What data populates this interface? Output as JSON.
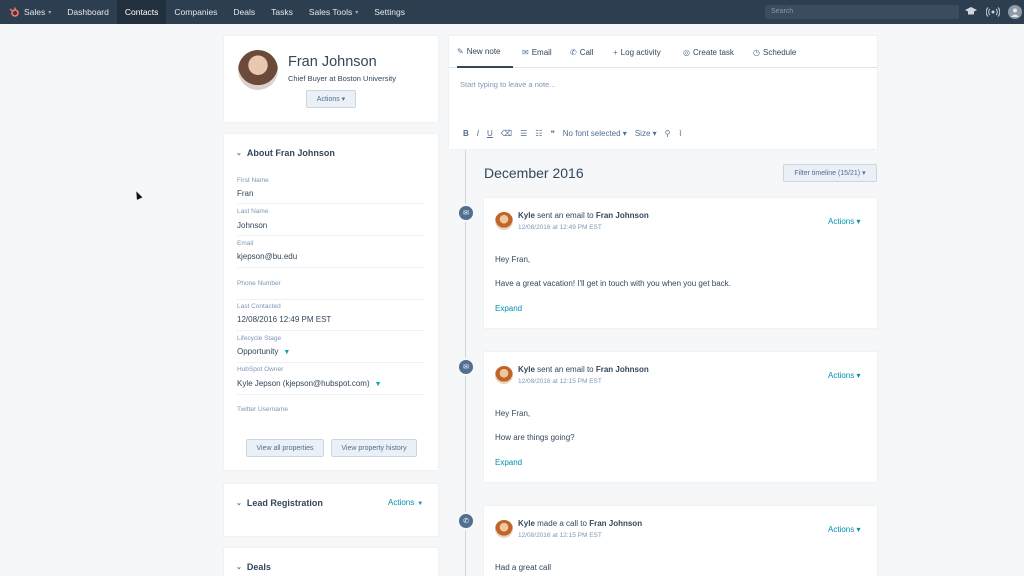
{
  "nav": {
    "items": [
      {
        "label": "Sales",
        "caret": "▾"
      },
      {
        "label": "Dashboard"
      },
      {
        "label": "Contacts"
      },
      {
        "label": "Companies"
      },
      {
        "label": "Deals"
      },
      {
        "label": "Tasks"
      },
      {
        "label": "Sales Tools",
        "caret": "▾"
      },
      {
        "label": "Settings"
      }
    ],
    "active": "Contacts",
    "search_placeholder": "Search",
    "icons": [
      "academy-icon",
      "broadcast-icon",
      "user-avatar-icon"
    ],
    "brand_color": "#ff7a59"
  },
  "contact": {
    "name": "Fran Johnson",
    "role": "Chief Buyer at Boston University",
    "actions_label": "Actions ▾"
  },
  "about": {
    "title": "About Fran Johnson",
    "fields": [
      {
        "label": "First Name",
        "value": "Fran"
      },
      {
        "label": "Last Name",
        "value": "Johnson"
      },
      {
        "label": "Email",
        "value": "kjepson@bu.edu"
      },
      {
        "label": "Phone Number",
        "value": ""
      },
      {
        "label": "Last Contacted",
        "value": "12/08/2016 12:49 PM EST"
      },
      {
        "label": "Lifecycle Stage",
        "value": "Opportunity"
      },
      {
        "label": "HubSpot Owner",
        "value": "Kyle Jepson (kjepson@hubspot.com)"
      },
      {
        "label": "Twitter Username",
        "value": ""
      }
    ],
    "view_all_label": "View all properties",
    "view_history_label": "View property history"
  },
  "lead_registration": {
    "title": "Lead Registration",
    "actions_label": "Actions"
  },
  "deals": {
    "title": "Deals"
  },
  "editor": {
    "tabs": [
      {
        "label": "New note",
        "icon": "pencil-icon"
      },
      {
        "label": "Email",
        "icon": "envelope-icon"
      },
      {
        "label": "Call",
        "icon": "phone-icon"
      },
      {
        "label": "Log activity",
        "icon": "plus-icon"
      },
      {
        "label": "Create task",
        "icon": "check-circle-icon"
      },
      {
        "label": "Schedule",
        "icon": "clock-icon"
      }
    ],
    "placeholder": "Start typing to leave a note...",
    "toolbar": {
      "bold": "B",
      "italic": "I",
      "underline": "U",
      "font": "No font selected ▾",
      "size": "Size ▾"
    }
  },
  "timeline": {
    "month": "December 2016",
    "filter_label": "Filter timeline (15/21) ▾",
    "events": [
      {
        "icon": "envelope-icon",
        "actor": "Kyle",
        "verb": "sent an email to",
        "target": "Fran Johnson",
        "time": "12/08/2016 at 12:49 PM EST",
        "lines": [
          "Hey Fran,",
          "Have a great vacation! I'll get in touch with you when you get back."
        ],
        "expand": "Expand",
        "actions": "Actions ▾"
      },
      {
        "icon": "envelope-icon",
        "actor": "Kyle",
        "verb": "sent an email to",
        "target": "Fran Johnson",
        "time": "12/08/2016 at 12:15 PM EST",
        "lines": [
          "Hey Fran,",
          "How are things going?"
        ],
        "expand": "Expand",
        "actions": "Actions ▾"
      },
      {
        "icon": "phone-icon",
        "actor": "Kyle",
        "verb": "made a call to",
        "target": "Fran Johnson",
        "time": "12/08/2016 at 12:15 PM EST",
        "lines": [
          "Had a great call"
        ],
        "actions": "Actions ▾"
      }
    ]
  }
}
